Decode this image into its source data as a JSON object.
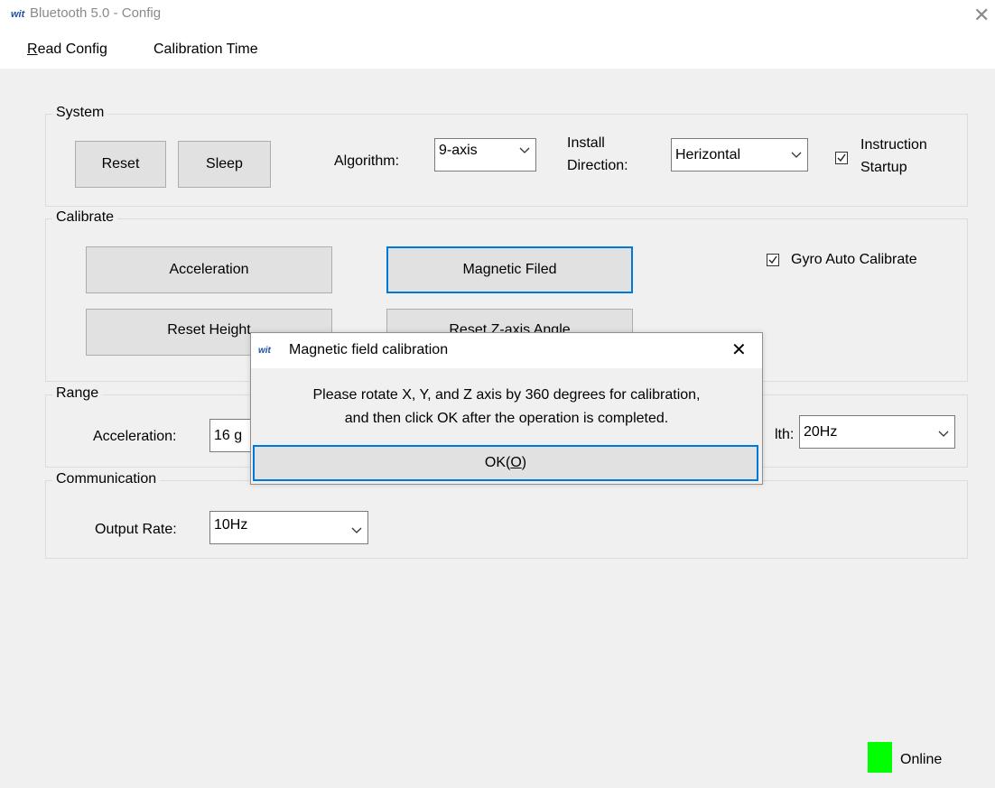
{
  "window": {
    "logo": "wit",
    "title": "Bluetooth 5.0 - Config",
    "close_glyph": "✕"
  },
  "menu": {
    "read_config": {
      "accel": "R",
      "rest": "ead Config"
    },
    "calibration_time": "Calibration Time"
  },
  "system": {
    "legend": "System",
    "reset_label": "Reset",
    "sleep_label": "Sleep",
    "algorithm_label": "Algorithm:",
    "algorithm_value": "9-axis",
    "install_label_1": "Install",
    "install_label_2": "Direction:",
    "install_value": "Herizontal",
    "instruction_label_1": "Instruction",
    "instruction_label_2": "Startup",
    "instruction_checked": true
  },
  "calibrate": {
    "legend": "Calibrate",
    "acceleration_label": "Acceleration",
    "magnetic_label": "Magnetic Filed",
    "reset_height_label": "Reset Height",
    "reset_z_label": "Reset Z-axis Angle",
    "gyro_label": "Gyro Auto Calibrate",
    "gyro_checked": true
  },
  "range": {
    "legend": "Range",
    "acceleration_label": "Acceleration:",
    "acceleration_value": "16 g",
    "bandwidth_label": "lth:",
    "bandwidth_value": "20Hz"
  },
  "communication": {
    "legend": "Communication",
    "output_rate_label": "Output Rate:",
    "output_rate_value": "10Hz"
  },
  "dialog": {
    "logo": "wit",
    "title": "Magnetic field calibration",
    "close_glyph": "✕",
    "message_line_1": "Please rotate X, Y, and Z axis by 360 degrees for calibration,",
    "message_line_2": "and then click OK after the operation is completed.",
    "ok_prefix": "OK(",
    "ok_accel": "O",
    "ok_suffix": ")"
  },
  "status": {
    "label": "Online",
    "color": "#00ff00"
  }
}
